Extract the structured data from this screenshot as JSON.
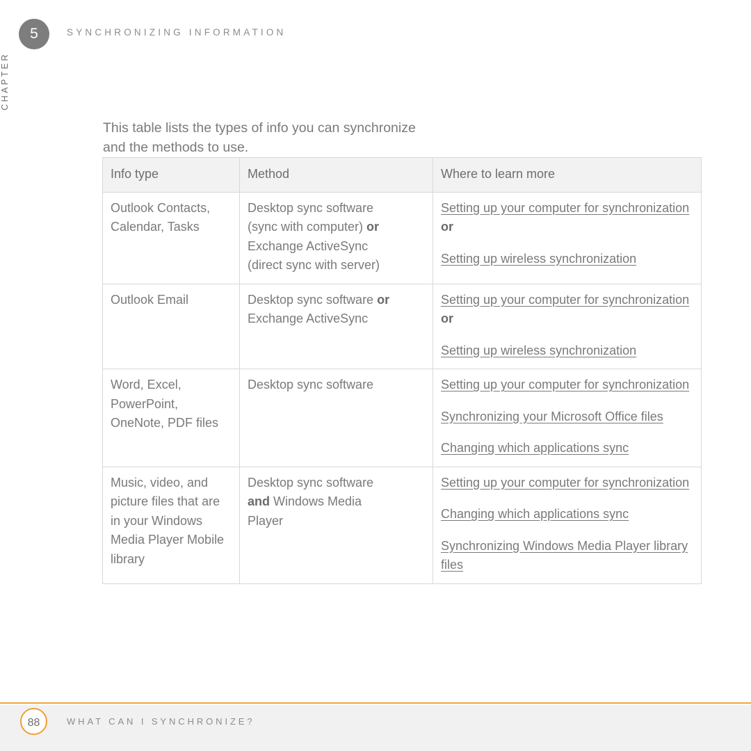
{
  "header": {
    "chapter_number": "5",
    "chapter_label": "CHAPTER",
    "title": "SYNCHRONIZING INFORMATION"
  },
  "intro": {
    "paragraph": "This table lists the types of info you can synchronize and the methods to use."
  },
  "table": {
    "columns": [
      "Info type",
      "Method",
      "Where to learn more"
    ],
    "rows": [
      {
        "info_type": "Outlook Contacts, Calendar, Tasks",
        "method_lines": [
          {
            "text": "Desktop sync software",
            "bold": ""
          },
          {
            "text": "(sync with computer) ",
            "bold": "or"
          },
          {
            "text": "Exchange ActiveSync",
            "bold": ""
          },
          {
            "text": "(direct sync with server)",
            "bold": ""
          }
        ],
        "links": [
          {
            "label": "Setting up your computer for synchronization",
            "suffix": "or"
          },
          {
            "label": "Setting up wireless synchronization",
            "suffix": ""
          }
        ]
      },
      {
        "info_type": "Outlook Email",
        "method_lines": [
          {
            "text": "Desktop sync software ",
            "bold": "or"
          },
          {
            "text": "Exchange ActiveSync",
            "bold": ""
          }
        ],
        "links": [
          {
            "label": "Setting up your computer for synchronization",
            "suffix": "or"
          },
          {
            "label": "Setting up wireless synchronization",
            "suffix": ""
          }
        ]
      },
      {
        "info_type": "Word, Excel, PowerPoint, OneNote, PDF files",
        "method_lines": [
          {
            "text": "Desktop sync software",
            "bold": ""
          }
        ],
        "links": [
          {
            "label": "Setting up your computer for synchronization",
            "suffix": ""
          },
          {
            "label": "Synchronizing your Microsoft Office files",
            "suffix": ""
          },
          {
            "label": "Changing which applications sync",
            "suffix": ""
          }
        ]
      },
      {
        "info_type": "Music, video, and picture files that are in your Windows Media Player Mobile library",
        "method_lines": [
          {
            "text": "Desktop sync software",
            "bold": ""
          },
          {
            "text": " Windows Media",
            "bold": "and",
            "bold_first": true
          },
          {
            "text": "Player",
            "bold": ""
          }
        ],
        "links": [
          {
            "label": "Setting up your computer for synchronization",
            "suffix": ""
          },
          {
            "label": "Changing which applications sync",
            "suffix": ""
          },
          {
            "label": "Synchronizing Windows Media Player library files",
            "suffix": ""
          }
        ]
      }
    ]
  },
  "footer": {
    "page_number": "88",
    "title": "WHAT CAN I SYNCHRONIZE?",
    "accent_color": "#f29e33"
  }
}
